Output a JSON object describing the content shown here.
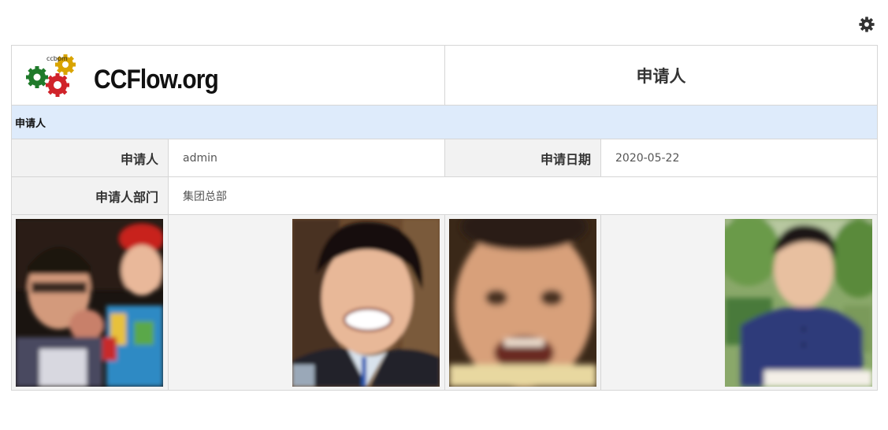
{
  "toolbar": {
    "settings_icon": "gear-icon"
  },
  "logo": {
    "brand_text": "CCFlow.org",
    "small_text": "ccbpm"
  },
  "form": {
    "title": "申请人",
    "section_title": "申请人",
    "fields": {
      "applicant_label": "申请人",
      "applicant_value": "admin",
      "apply_date_label": "申请日期",
      "apply_date_value": "2020-05-22",
      "department_label": "申请人部门",
      "department_value": "集团总部"
    },
    "photos": [
      {
        "name": "photo-man-with-child"
      },
      {
        "name": "photo-smiling-man"
      },
      {
        "name": "photo-laughing-child"
      },
      {
        "name": "photo-man-outdoors"
      }
    ]
  },
  "colors": {
    "section_bg": "#deebfb",
    "label_bg": "#f2f2f2",
    "border": "#c8c8c8"
  }
}
